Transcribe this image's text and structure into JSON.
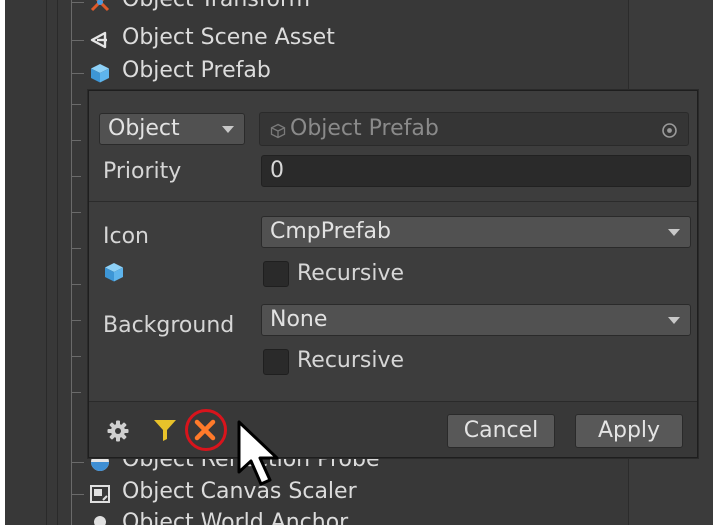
{
  "tree": {
    "items": [
      {
        "label": "Object Transform",
        "icon": "transform-icon"
      },
      {
        "label": "Object Scene Asset",
        "icon": "scene-asset-icon"
      },
      {
        "label": "Object Prefab",
        "icon": "prefab-cube-icon"
      },
      {
        "label": "Object Reflection Probe",
        "icon": "reflection-probe-icon"
      },
      {
        "label": "Object Canvas Scaler",
        "icon": "canvas-scaler-icon"
      },
      {
        "label": "Object World Anchor",
        "icon": "world-anchor-icon"
      }
    ]
  },
  "popup": {
    "type_dropdown": "Object",
    "object_field_value": "Object Prefab",
    "priority_label": "Priority",
    "priority_value": "0",
    "icon_label": "Icon",
    "icon_value": "CmpPrefab",
    "icon_recursive_label": "Recursive",
    "background_label": "Background",
    "background_value": "None",
    "background_recursive_label": "Recursive",
    "cancel_label": "Cancel",
    "apply_label": "Apply"
  },
  "colors": {
    "prefab_blue": "#4ea7e6",
    "filter_yellow": "#e8c22a",
    "remove_orange": "#ff7a2a",
    "highlight_red": "#d8141c"
  }
}
